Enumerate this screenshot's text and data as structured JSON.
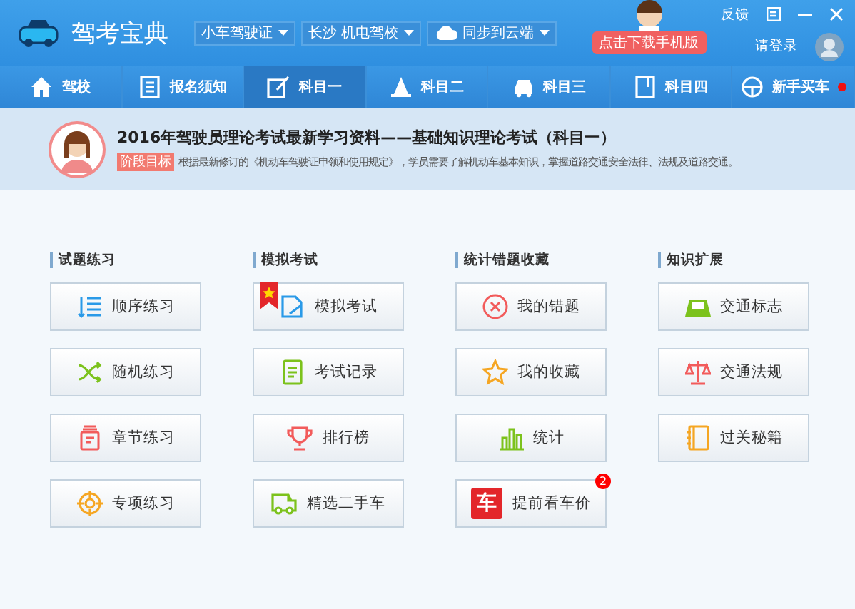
{
  "app": {
    "title": "驾考宝典",
    "dropdowns": [
      {
        "label": "小车驾驶证",
        "kind": "plain"
      },
      {
        "label": "长沙 机电驾校",
        "kind": "plain"
      },
      {
        "label": "同步到云端",
        "kind": "cloud"
      }
    ],
    "download_button": "点击下载手机版",
    "feedback": "反馈",
    "login": "请登录"
  },
  "tabs": [
    {
      "label": "驾校",
      "selected": false,
      "dot": false
    },
    {
      "label": "报名须知",
      "selected": false,
      "dot": false
    },
    {
      "label": "科目一",
      "selected": true,
      "dot": false
    },
    {
      "label": "科目二",
      "selected": false,
      "dot": false
    },
    {
      "label": "科目三",
      "selected": false,
      "dot": false
    },
    {
      "label": "科目四",
      "selected": false,
      "dot": false
    },
    {
      "label": "新手买车",
      "selected": false,
      "dot": true
    }
  ],
  "banner": {
    "title": "2016年驾驶员理论考试最新学习资料——基础知识理论考试（科目一）",
    "tag": "阶段目标",
    "text": "根据最新修订的《机动车驾驶证申领和使用规定》，学员需要了解机动车基本知识，掌握道路交通安全法律、法规及道路交通。"
  },
  "sections": [
    {
      "title": "试题练习",
      "buttons": [
        {
          "label": "顺序练习"
        },
        {
          "label": "随机练习"
        },
        {
          "label": "章节练习"
        },
        {
          "label": "专项练习"
        }
      ]
    },
    {
      "title": "模拟考试",
      "buttons": [
        {
          "label": "模拟考试",
          "flagged": true
        },
        {
          "label": "考试记录"
        },
        {
          "label": "排行榜"
        },
        {
          "label": "精选二手车"
        }
      ]
    },
    {
      "title": "统计错题收藏",
      "buttons": [
        {
          "label": "我的错题"
        },
        {
          "label": "我的收藏"
        },
        {
          "label": "统计"
        },
        {
          "label": "提前看车价",
          "icon_text": "车",
          "badge": "2"
        }
      ]
    },
    {
      "title": "知识扩展",
      "buttons": [
        {
          "label": "交通标志"
        },
        {
          "label": "交通法规"
        },
        {
          "label": "过关秘籍"
        }
      ]
    }
  ]
}
